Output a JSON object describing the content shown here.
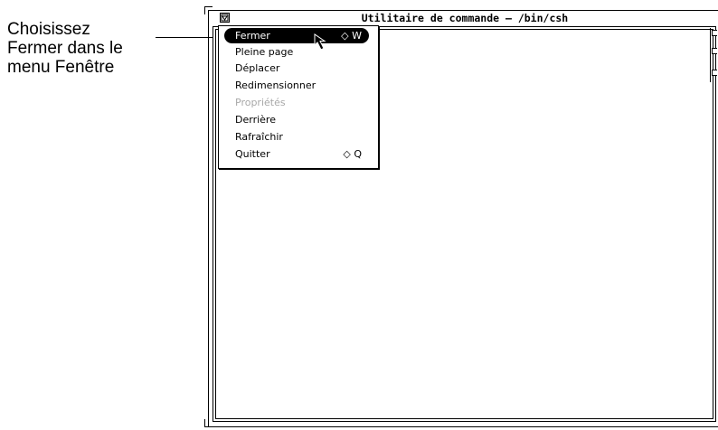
{
  "callout": {
    "lines": [
      "Choisissez",
      "Fermer dans le",
      "menu Fenêtre"
    ]
  },
  "window": {
    "title": "Utilitaire de commande – /bin/csh"
  },
  "menu": {
    "items": [
      {
        "label": "Fermer",
        "accel": "◇ W",
        "selected": true,
        "disabled": false
      },
      {
        "label": "Pleine page",
        "accel": "",
        "selected": false,
        "disabled": false
      },
      {
        "label": "Déplacer",
        "accel": "",
        "selected": false,
        "disabled": false
      },
      {
        "label": "Redimensionner",
        "accel": "",
        "selected": false,
        "disabled": false
      },
      {
        "label": "Propriétés",
        "accel": "",
        "selected": false,
        "disabled": true
      },
      {
        "label": "Derrière",
        "accel": "",
        "selected": false,
        "disabled": false
      },
      {
        "label": "Rafraîchir",
        "accel": "",
        "selected": false,
        "disabled": false
      },
      {
        "label": "Quitter",
        "accel": "◇ Q",
        "selected": false,
        "disabled": false
      }
    ]
  },
  "icons": {
    "window_menu": "triangle-down-icon",
    "pointer": "arrow-pointer-icon"
  }
}
